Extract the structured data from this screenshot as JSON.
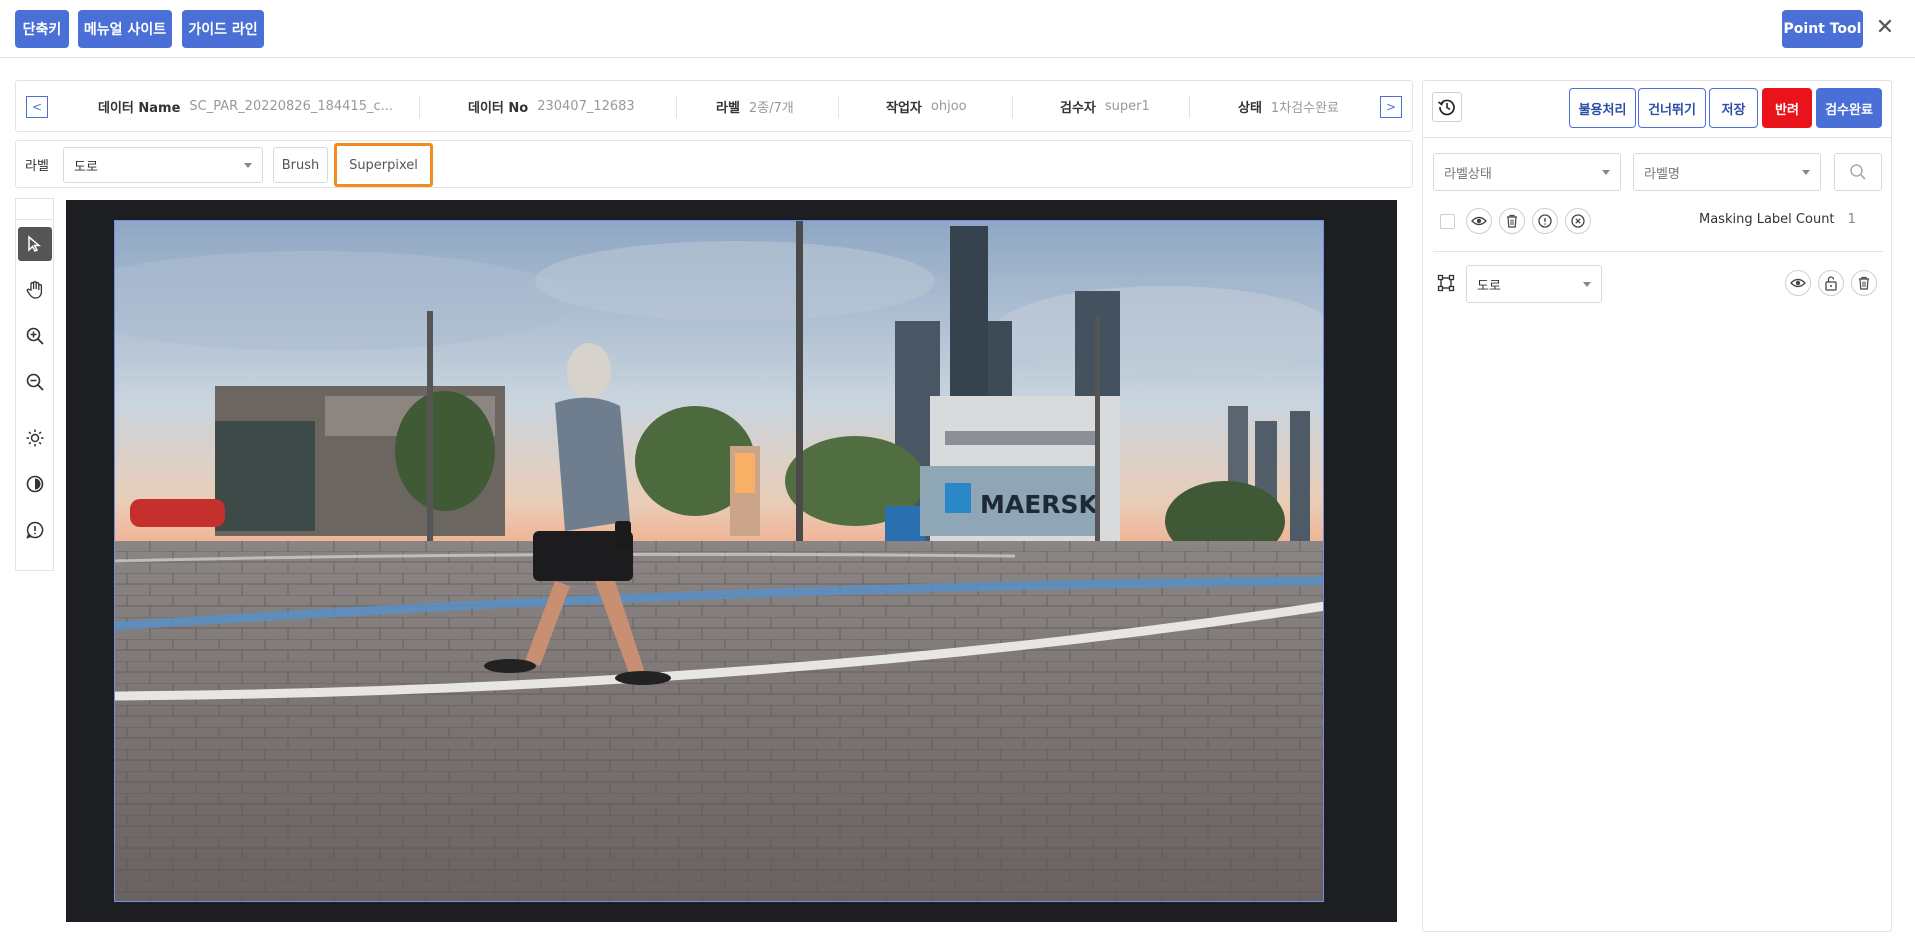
{
  "topbar": {
    "shortcuts_label": "단축키",
    "manual_label": "메뉴얼 사이트",
    "guide_label": "가이드 라인",
    "point_tool_label": "Point Tool",
    "close_glyph": "✕"
  },
  "info": {
    "prev_glyph": "<",
    "next_glyph": ">",
    "items": [
      {
        "key": "데이터 Name",
        "value": "SC_PAR_20220826_184415_c..."
      },
      {
        "key": "데이터 No",
        "value": "230407_12683"
      },
      {
        "key": "라벨",
        "value": "2종/7개"
      },
      {
        "key": "작업자",
        "value": "ohjoo"
      },
      {
        "key": "검수자",
        "value": "super1"
      },
      {
        "key": "상태",
        "value": "1차검수완료"
      }
    ]
  },
  "labelbar": {
    "label_text": "라벨",
    "selected_label": "도로",
    "brush_label": "Brush",
    "superpixel_label": "Superpixel"
  },
  "tools": [
    "select-arrow-icon",
    "hand-pan-icon",
    "zoom-in-icon",
    "zoom-out-icon",
    "brightness-icon",
    "contrast-icon",
    "alert-icon"
  ],
  "scene": {
    "container_text": "MAERSK"
  },
  "right": {
    "actions": {
      "defect": "불용처리",
      "skip": "건너뛰기",
      "save": "저장",
      "reject": "반려",
      "review_done": "검수완료"
    },
    "filters": {
      "status_placeholder": "라벨상태",
      "name_placeholder": "라벨명"
    },
    "masking_label_count_text": "Masking Label Count",
    "masking_label_count": "1",
    "label_item": {
      "name": "도로"
    }
  },
  "colors": {
    "primary": "#4a6fd6",
    "reject": "#e8141a",
    "highlight": "#f28c1e",
    "canvas_bg": "#1d1e22"
  }
}
